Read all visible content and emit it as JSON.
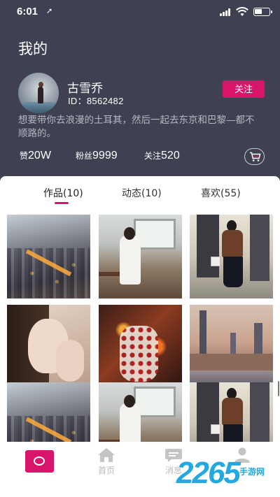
{
  "status_bar": {
    "time": "6:01",
    "location_arrow": "➚"
  },
  "header": {
    "title": "我的"
  },
  "profile": {
    "username": "古雪乔",
    "user_id": "ID：8562482",
    "follow_label": "关注",
    "bio": "想要带你去浪漫的土耳其，然后一起去东京和巴黎—都不顺路的。"
  },
  "stats": {
    "likes_key": "赞",
    "likes_value": "20W",
    "fans_key": "粉丝",
    "fans_value": "9999",
    "following_key": "关注",
    "following_value": "520"
  },
  "tabs": [
    {
      "label": "作品(10)",
      "active": true
    },
    {
      "label": "动态(10)",
      "active": false
    },
    {
      "label": "喜欢(55)",
      "active": false
    }
  ],
  "grid": [
    {
      "icon": "city-night-photo"
    },
    {
      "icon": "cafe-woman-photo"
    },
    {
      "icon": "street-fashion-photo"
    },
    {
      "icon": "portrait-photo"
    },
    {
      "icon": "bokeh-dress-photo"
    },
    {
      "icon": "city-skyline-photo"
    },
    {
      "icon": "city-night-photo"
    },
    {
      "icon": "cafe-woman-photo"
    },
    {
      "icon": "street-fashion-photo"
    }
  ],
  "tabbar": {
    "home_label": "首页",
    "messages_label": "消息"
  },
  "watermark": {
    "big": "2265",
    "small": "手游网"
  },
  "colors": {
    "accent": "#d9146b",
    "header_bg": "#3f4152"
  }
}
